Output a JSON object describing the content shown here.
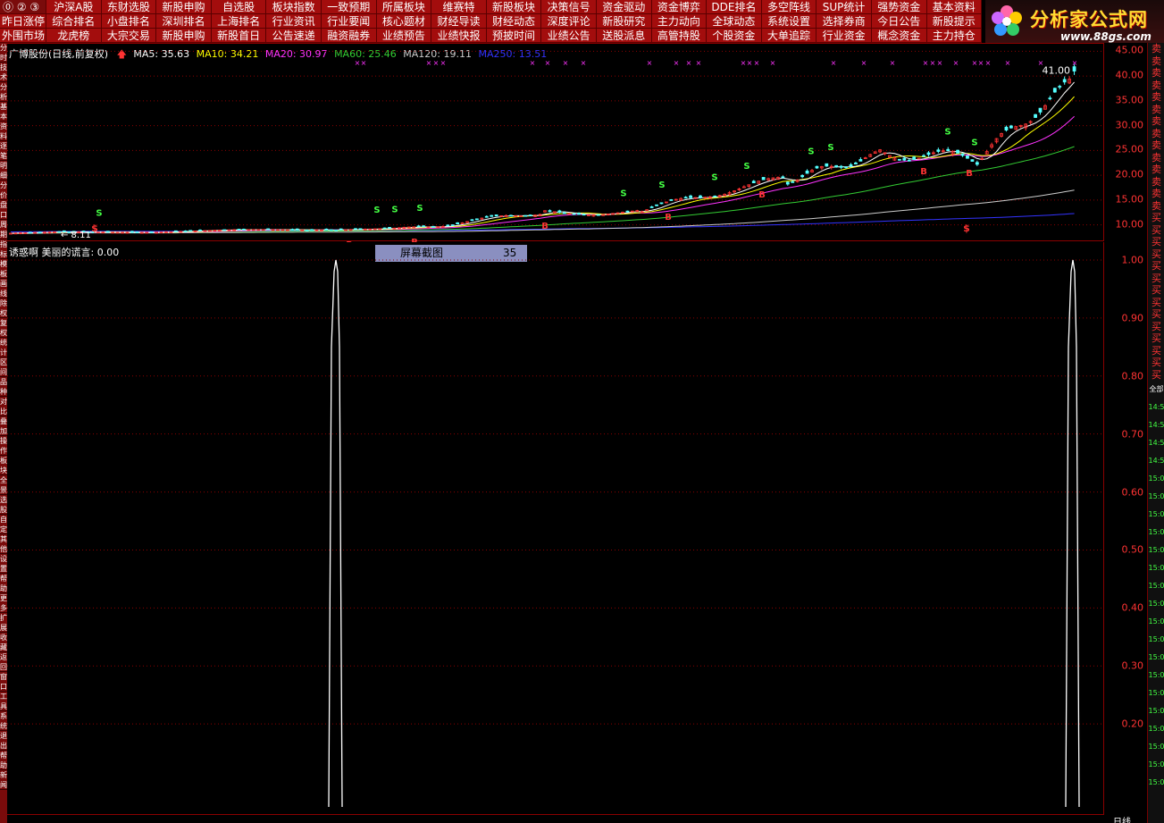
{
  "menu": {
    "row0": [
      "沪深A股",
      "东财选股",
      "新股申购",
      "自选股",
      "板块指数",
      "一致预期",
      "所属板块",
      "维赛特",
      "新股板块",
      "决策信号",
      "资金驱动",
      "资金博弈",
      "DDE排名",
      "多空阵线",
      "SUP统计",
      "强势资金",
      "基本资料"
    ],
    "row0_nav": "⓪ ② ③",
    "row1_first": "昨日涨停",
    "row1": [
      "综合排名",
      "小盘排名",
      "深圳排名",
      "上海排名",
      "行业资讯",
      "行业要闻",
      "核心题材",
      "财经导读",
      "财经动态",
      "深度评论",
      "新股研究",
      "主力动向",
      "全球动态",
      "系统设置",
      "选择券商",
      "今日公告",
      "新股提示"
    ],
    "row2_first": "外围市场",
    "row2": [
      "龙虎榜",
      "大宗交易",
      "新股申购",
      "新股首日",
      "公告速递",
      "融资融券",
      "业绩预告",
      "业绩快报",
      "预披时间",
      "业绩公告",
      "送股派息",
      "高管持股",
      "个股资金",
      "大单追踪",
      "行业资金",
      "概念资金",
      "主力持仓"
    ]
  },
  "logo": {
    "brand": "分析家公式网",
    "url": "www.88gs.com"
  },
  "left_tabs": [
    "分时",
    "技术",
    "分析",
    "基本",
    "资料",
    "逐笔",
    "明细",
    "分价",
    "盘口",
    "周期",
    "指标",
    "模板",
    "画线",
    "除权",
    "复权",
    "统计",
    "区间",
    "品种",
    "对比",
    "叠加",
    "操作",
    "板块",
    "全景",
    "选股",
    "自定",
    "其他",
    "设置",
    "帮助",
    "更多",
    "扩展",
    "收藏",
    "返回",
    "窗口",
    "工具",
    "系统",
    "退出",
    "帮助",
    "新闻"
  ],
  "right_strip": {
    "sell": [
      "卖",
      "卖",
      "卖",
      "卖",
      "卖",
      "卖",
      "卖",
      "卖",
      "卖",
      "卖",
      "卖",
      "卖",
      "卖",
      "卖"
    ],
    "buy": [
      "买",
      "买",
      "买",
      "买",
      "买",
      "买",
      "买",
      "买",
      "买",
      "买",
      "买",
      "买",
      "买",
      "买"
    ],
    "tab": "全部",
    "times": [
      "14:5",
      "14:5",
      "14:5",
      "14:5",
      "15:0",
      "15:0",
      "15:0",
      "15:0",
      "15:0",
      "15:0",
      "15:0",
      "15:0",
      "15:0",
      "15:0",
      "15:0",
      "15:0",
      "15:0",
      "15:0",
      "15:0",
      "15:0",
      "15:0",
      "15:0"
    ]
  },
  "main_title": {
    "stock": "广博股份(日线,前复权)",
    "ma5": "MA5: 35.63",
    "ma10": "MA10: 34.21",
    "ma20": "MA20: 30.97",
    "ma60": "MA60: 25.46",
    "ma120": "MA120: 19.11",
    "ma250": "MA250: 13.51",
    "high_label": "41.00",
    "low_label": "8.11"
  },
  "colors": {
    "ma5": "#ffffff",
    "ma10": "#ffff00",
    "ma20": "#ff33ff",
    "ma60": "#33cc33",
    "ma120": "#cccccc",
    "ma250": "#3333ff",
    "up": "#ff3333",
    "down": "#55ffff",
    "grid": "#8b0000",
    "axis_label": "#ff3333"
  },
  "main_yaxis": [
    "45.00",
    "40.00",
    "35.00",
    "30.00",
    "25.00",
    "20.00",
    "15.00",
    "10.00"
  ],
  "indicator": {
    "title": "诱惑啊 美丽的谎言: 0.00",
    "yaxis": [
      "1.00",
      "0.90",
      "0.80",
      "0.70",
      "0.60",
      "0.50",
      "0.40",
      "0.30",
      "0.20"
    ],
    "bottom_right": "日线"
  },
  "screenshot_box": {
    "label": "屏幕截图",
    "value": "35"
  },
  "signals": {
    "sell": "S",
    "buy": "B"
  }
}
